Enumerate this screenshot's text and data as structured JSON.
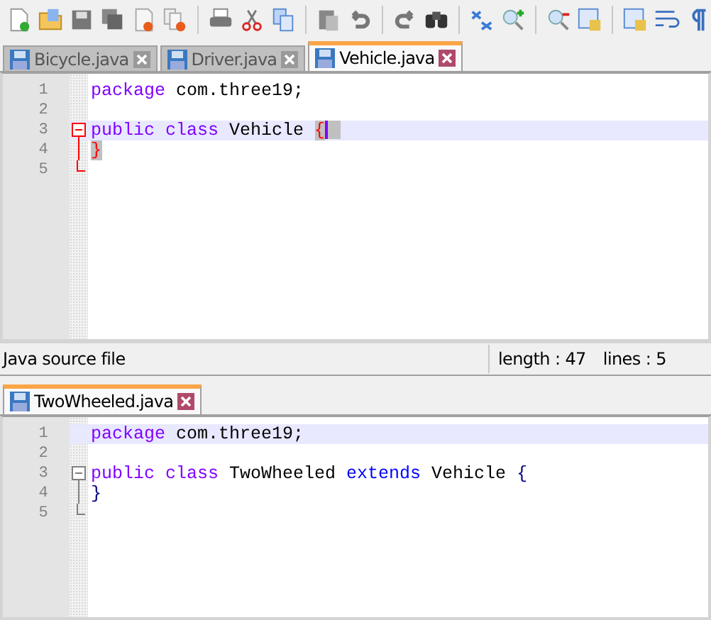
{
  "panes": [
    {
      "active": true,
      "tabs": [
        {
          "label": "Bicycle.java",
          "selected": false
        },
        {
          "label": "Driver.java",
          "selected": false
        },
        {
          "label": "Vehicle.java",
          "selected": true
        }
      ],
      "lines": [
        {
          "number": "1",
          "current": false,
          "caret": false,
          "kind": "plain",
          "tokens": [
            {
              "text": "package",
              "kind": "keyword"
            },
            {
              "text": " com.three19;",
              "kind": "plain"
            }
          ]
        },
        {
          "number": "2",
          "current": false,
          "caret": false,
          "kind": "plain"
        },
        {
          "number": "3",
          "current": true,
          "caret": true,
          "kind": "fold-start",
          "tokens": [
            {
              "text": "public class",
              "kind": "keyword"
            },
            {
              "text": " Vehicle ",
              "kind": "plain"
            },
            {
              "text": "{",
              "kind": "brace-match"
            }
          ]
        },
        {
          "number": "4",
          "current": false,
          "caret": false,
          "kind": "fold-body",
          "tokens": [
            {
              "text": "}",
              "kind": "brace-match"
            }
          ]
        },
        {
          "number": "5",
          "current": false,
          "caret": false,
          "kind": "fold-end"
        }
      ]
    },
    {
      "active": false,
      "tabs": [
        {
          "label": "TwoWheeled.java",
          "selected": true
        }
      ],
      "lines": [
        {
          "number": "1",
          "current": true,
          "caret": false,
          "kind": "plain",
          "tokens": [
            {
              "text": "package",
              "kind": "keyword"
            },
            {
              "text": " com.three19;",
              "kind": "plain"
            }
          ]
        },
        {
          "number": "2",
          "current": false,
          "caret": false,
          "kind": "plain"
        },
        {
          "number": "3",
          "current": false,
          "caret": false,
          "kind": "fold-start",
          "tokens": [
            {
              "text": "public class",
              "kind": "keyword"
            },
            {
              "text": " TwoWheeled ",
              "kind": "plain"
            },
            {
              "text": "extends",
              "kind": "keyword2"
            },
            {
              "text": " Vehicle ",
              "kind": "plain"
            },
            {
              "text": "{",
              "kind": "brace"
            }
          ]
        },
        {
          "number": "4",
          "current": false,
          "caret": false,
          "kind": "fold-body",
          "tokens": [
            {
              "text": "}",
              "kind": "brace"
            }
          ]
        },
        {
          "number": "5",
          "current": false,
          "caret": false,
          "kind": "fold-end"
        }
      ]
    }
  ],
  "status_bar": {
    "file_type": "Java source file",
    "length": "length : 47",
    "lines": "lines : 5"
  }
}
